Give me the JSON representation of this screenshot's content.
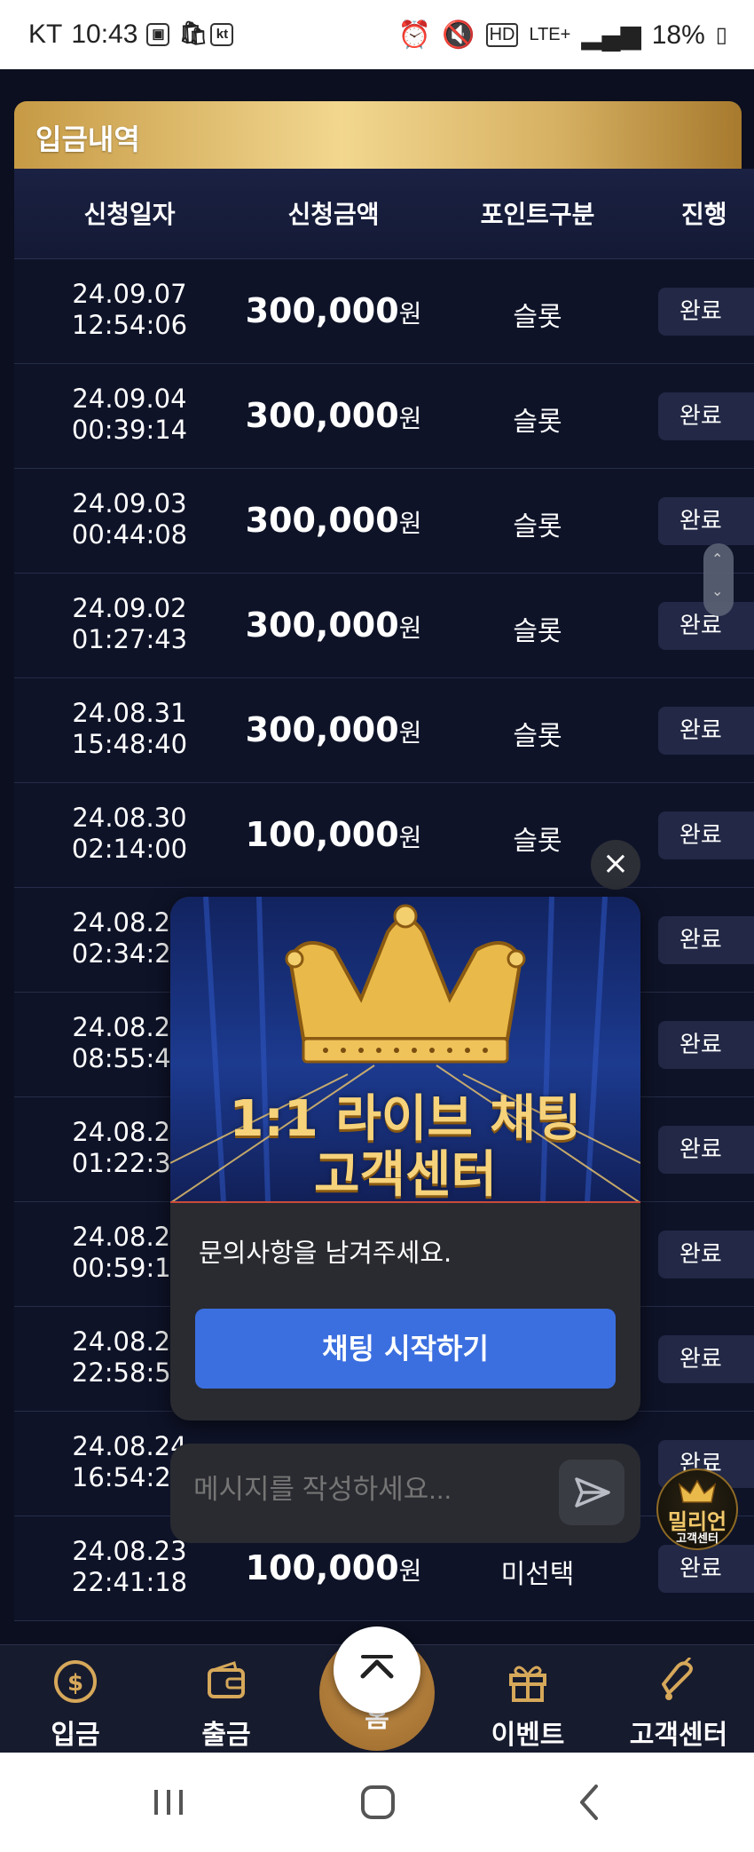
{
  "status_bar": {
    "carrier": "KT",
    "time": "10:43",
    "kt_badge": "kt",
    "network": "LTE+",
    "battery": "18%"
  },
  "panel": {
    "title": "입금내역"
  },
  "table": {
    "headers": [
      "신청일자",
      "신청금액",
      "포인트구분",
      "진행"
    ],
    "rows": [
      {
        "date": "24.09.07",
        "time": "12:54:06",
        "amount": "300,000",
        "unit": "원",
        "type": "슬롯",
        "status": "완료"
      },
      {
        "date": "24.09.04",
        "time": "00:39:14",
        "amount": "300,000",
        "unit": "원",
        "type": "슬롯",
        "status": "완료"
      },
      {
        "date": "24.09.03",
        "time": "00:44:08",
        "amount": "300,000",
        "unit": "원",
        "type": "슬롯",
        "status": "완료"
      },
      {
        "date": "24.09.02",
        "time": "01:27:43",
        "amount": "300,000",
        "unit": "원",
        "type": "슬롯",
        "status": "완료"
      },
      {
        "date": "24.08.31",
        "time": "15:48:40",
        "amount": "300,000",
        "unit": "원",
        "type": "슬롯",
        "status": "완료"
      },
      {
        "date": "24.08.30",
        "time": "02:14:00",
        "amount": "100,000",
        "unit": "원",
        "type": "슬롯",
        "status": "완료"
      },
      {
        "date": "24.08.29",
        "time": "02:34:29",
        "amount": "",
        "unit": "",
        "type": "",
        "status": "완료"
      },
      {
        "date": "24.08.28",
        "time": "08:55:40",
        "amount": "",
        "unit": "",
        "type": "",
        "status": "완료"
      },
      {
        "date": "24.08.27",
        "time": "01:22:39",
        "amount": "",
        "unit": "",
        "type": "",
        "status": "완료"
      },
      {
        "date": "24.08.26",
        "time": "00:59:14",
        "amount": "",
        "unit": "",
        "type": "",
        "status": "완료"
      },
      {
        "date": "24.08.25",
        "time": "22:58:59",
        "amount": "",
        "unit": "",
        "type": "",
        "status": "완료"
      },
      {
        "date": "24.08.24",
        "time": "16:54:28",
        "amount": "",
        "unit": "",
        "type": "",
        "status": "완료"
      },
      {
        "date": "24.08.23",
        "time": "22:41:18",
        "amount": "100,000",
        "unit": "원",
        "type": "미선택",
        "status": "완료"
      }
    ]
  },
  "popup": {
    "banner_line1": "1:1 라이브 채팅",
    "banner_line2": "고객센터",
    "message": "문의사항을 남겨주세요.",
    "button": "채팅 시작하기",
    "input_placeholder": "메시지를 작성하세요..."
  },
  "cs_badge": {
    "line1": "밀리언",
    "line2": "고객센터"
  },
  "bottom_nav": {
    "items": [
      {
        "label": "입금",
        "icon": "dollar-coin-icon"
      },
      {
        "label": "출금",
        "icon": "wallet-icon"
      },
      {
        "label": "홈",
        "icon": "home-icon"
      },
      {
        "label": "이벤트",
        "icon": "gift-icon"
      },
      {
        "label": "고객센터",
        "icon": "bell-icon"
      }
    ]
  },
  "colors": {
    "gold": "#d6b062",
    "accent_blue": "#3b6fe0",
    "background": "#0b0f1f"
  }
}
